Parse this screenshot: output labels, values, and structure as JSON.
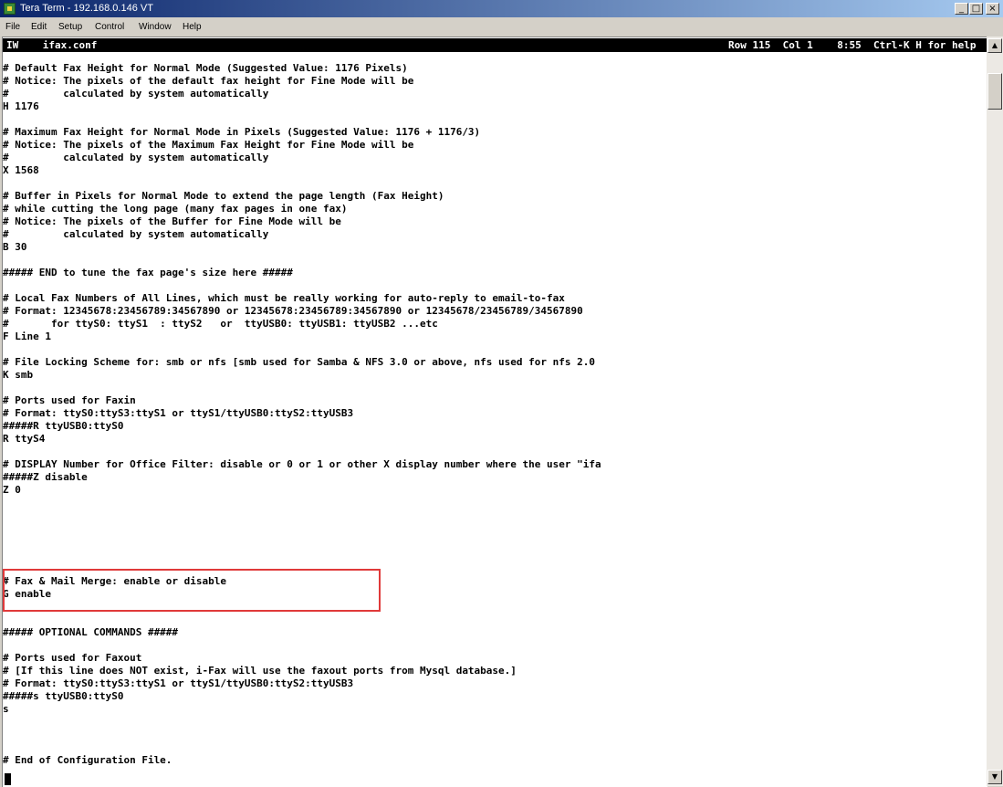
{
  "window": {
    "title": "Tera Term - 192.168.0.146 VT",
    "controls": {
      "minimize": "_",
      "maximize": "□",
      "close": "×"
    }
  },
  "menu": [
    {
      "label": "File"
    },
    {
      "label": "Edit"
    },
    {
      "label": "Setup"
    },
    {
      "label": "Control"
    },
    {
      "label": "Window"
    },
    {
      "label": "Help"
    }
  ],
  "editor_status": {
    "left": "IW    ifax.conf",
    "right": "Row 115  Col 1    8:55  Ctrl-K H for help"
  },
  "terminal_lines": [
    "# Default Fax Height for Normal Mode (Suggested Value: 1176 Pixels)",
    "# Notice: The pixels of the default fax height for Fine Mode will be",
    "#         calculated by system automatically",
    "H 1176",
    "",
    "# Maximum Fax Height for Normal Mode in Pixels (Suggested Value: 1176 + 1176/3)",
    "# Notice: The pixels of the Maximum Fax Height for Fine Mode will be",
    "#         calculated by system automatically",
    "X 1568",
    "",
    "# Buffer in Pixels for Normal Mode to extend the page length (Fax Height)",
    "# while cutting the long page (many fax pages in one fax)",
    "# Notice: The pixels of the Buffer for Fine Mode will be",
    "#         calculated by system automatically",
    "B 30",
    "",
    "##### END to tune the fax page's size here #####",
    "",
    "# Local Fax Numbers of All Lines, which must be really working for auto-reply to email-to-fax",
    "# Format: 12345678:23456789:34567890 or 12345678:23456789:34567890 or 12345678/23456789/34567890",
    "#       for ttyS0: ttyS1  : ttyS2   or  ttyUSB0: ttyUSB1: ttyUSB2 ...etc",
    "F Line 1",
    "",
    "# File Locking Scheme for: smb or nfs [smb used for Samba & NFS 3.0 or above, nfs used for nfs 2.0",
    "K smb",
    "",
    "# Ports used for Faxin",
    "# Format: ttyS0:ttyS3:ttyS1 or ttyS1/ttyUSB0:ttyS2:ttyUSB3",
    "#####R ttyUSB0:ttyS0",
    "R ttyS4",
    "",
    "# DISPLAY Number for Office Filter: disable or 0 or 1 or other X display number where the user \"ifa",
    "#####Z disable",
    "Z 0",
    "",
    "# Fax & Mail Merge: enable or disable",
    "G enable",
    "",
    "##### OPTIONAL COMMANDS #####",
    "",
    "# Ports used for Faxout",
    "# [If this line does NOT exist, i-Fax will use the faxout ports from Mysql database.]",
    "# Format: ttyS0:ttyS3:ttyS1 or ttyS1/ttyUSB0:ttyS2:ttyUSB3",
    "#####s ttyUSB0:ttyS0",
    "s",
    "",
    "# End of Configuration File."
  ],
  "highlight_color": "#e03a3a",
  "icons": {
    "app": "tera-term-icon",
    "scroll_up": "up-arrow-icon",
    "scroll_down": "down-arrow-icon"
  }
}
